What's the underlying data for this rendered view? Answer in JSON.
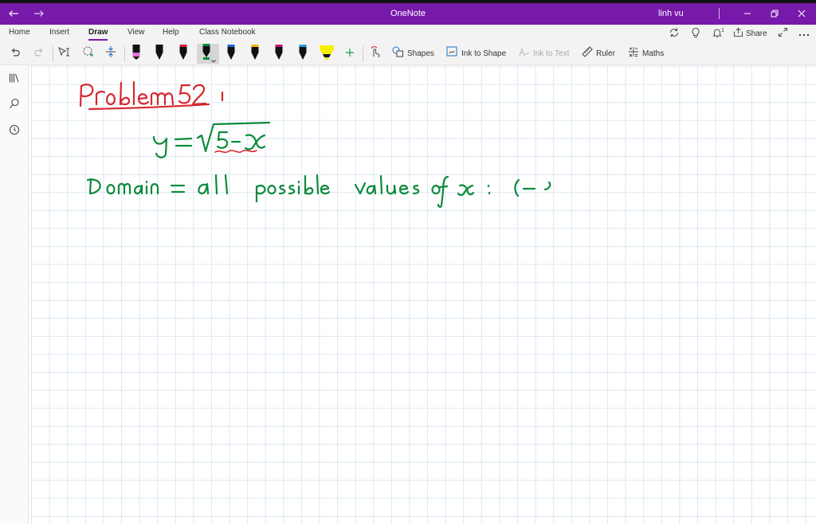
{
  "window": {
    "title": "OneNote",
    "user": "linh vu",
    "back_icon": "arrow-left-icon",
    "forward_icon": "arrow-right-icon",
    "minimize_icon": "minimize-icon",
    "restore_icon": "restore-icon",
    "close_icon": "close-icon",
    "accent_color": "#7719aa"
  },
  "tabs": [
    {
      "label": "Home"
    },
    {
      "label": "Insert"
    },
    {
      "label": "Draw",
      "active": true
    },
    {
      "label": "View"
    },
    {
      "label": "Help"
    },
    {
      "label": "Class Notebook"
    }
  ],
  "ribbon_right": {
    "sync_icon": "sync-icon",
    "tell_me_icon": "lightbulb-icon",
    "notifications_icon": "bell-icon",
    "notification_count": "1",
    "share_label": "Share",
    "expand_icon": "expand-icon",
    "more_icon": "more-icon"
  },
  "toolbar": {
    "undo_icon": "undo-icon",
    "redo_icon": "redo-icon",
    "type_select_icon": "type-select-icon",
    "lasso_icon": "lasso-icon",
    "add_space_icon": "add-space-icon",
    "pens": [
      {
        "name": "pen-black-pink",
        "color": "#000000",
        "band": "#e06fd0"
      },
      {
        "name": "pen-black-1",
        "color": "#000000",
        "band": "#000000"
      },
      {
        "name": "pen-red",
        "color": "#000000",
        "band": "#d21f2b"
      },
      {
        "name": "pen-green",
        "color": "#000000",
        "band": "#0b8a3a",
        "selected": true
      },
      {
        "name": "pen-blue",
        "color": "#000000",
        "band": "#1e63d6"
      },
      {
        "name": "pen-yellow",
        "color": "#000000",
        "band": "#f2b400"
      },
      {
        "name": "pen-magenta",
        "color": "#000000",
        "band": "#c0167a"
      },
      {
        "name": "pen-cyan",
        "color": "#000000",
        "band": "#1ea2d8"
      },
      {
        "name": "highlighter-yellow",
        "color": "#f5f000",
        "band": "#f5f000"
      }
    ],
    "add_pen_icon": "plus-icon",
    "touch_draw_icon": "touch-draw-icon",
    "shapes_label": "Shapes",
    "ink_to_shape_label": "Ink to Shape",
    "ink_to_text_label": "Ink to Text",
    "ruler_label": "Ruler",
    "maths_label": "Maths"
  },
  "rail": {
    "notebooks_icon": "notebooks-icon",
    "search_icon": "search-icon",
    "recent_icon": "clock-icon"
  },
  "ink": {
    "red_color": "#d6272e",
    "green_color": "#0d8a3c",
    "underline_color": "#d6272e"
  }
}
